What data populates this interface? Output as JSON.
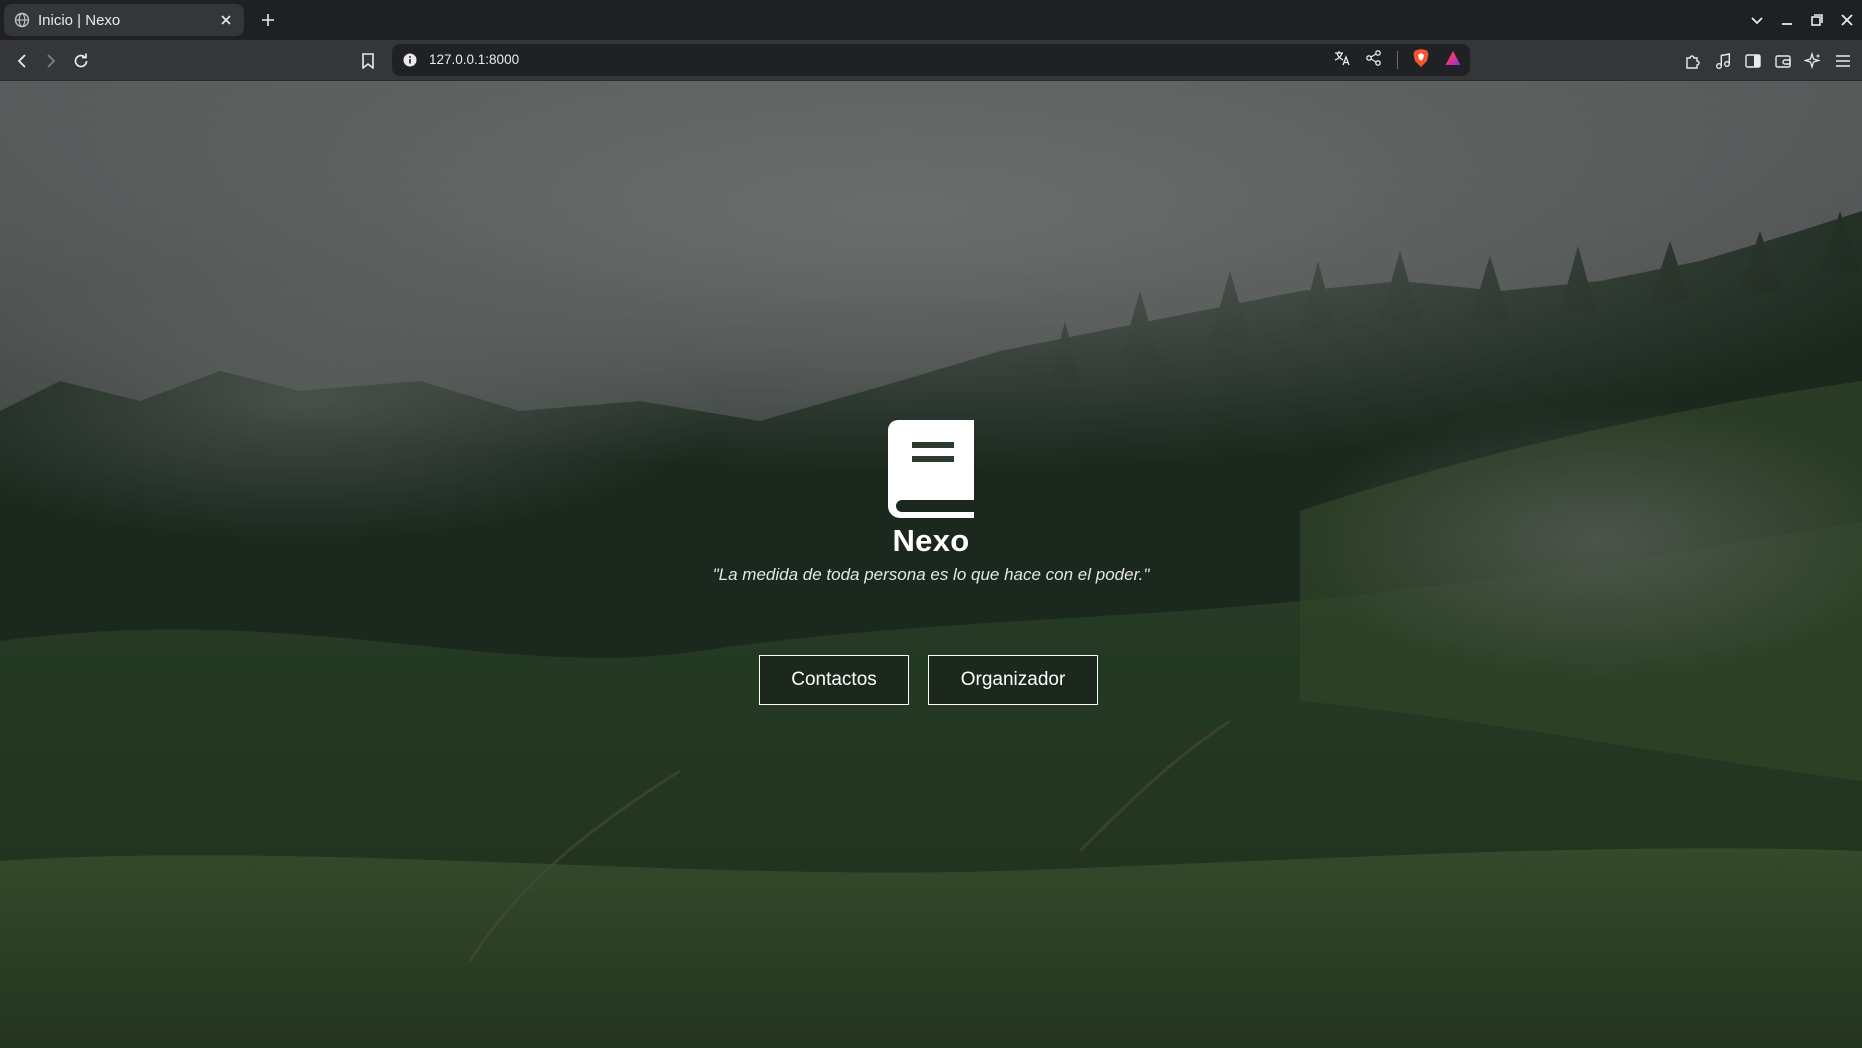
{
  "browser": {
    "tab": {
      "title": "Inicio | Nexo"
    },
    "address_bar": {
      "url": "127.0.0.1:8000"
    }
  },
  "page": {
    "brand": "Nexo",
    "quote": "\"La medida de toda persona es lo que hace con el poder.\"",
    "buttons": {
      "contactos": "Contactos",
      "organizador": "Organizador"
    }
  },
  "colors": {
    "tab_strip": "#1f2023",
    "toolbar": "#35363a",
    "omnibox": "#202124",
    "brave_shield": "#fb542b"
  },
  "icons": {
    "logo": "book-icon",
    "toolbar": [
      "back-icon",
      "forward-icon",
      "reload-icon",
      "bookmark-icon",
      "site-info-icon",
      "translate-icon",
      "share-icon",
      "brave-shield-icon",
      "brave-rewards-icon",
      "extensions-icon",
      "media-icon",
      "sidebar-icon",
      "wallet-icon",
      "leo-ai-icon",
      "menu-icon"
    ]
  }
}
